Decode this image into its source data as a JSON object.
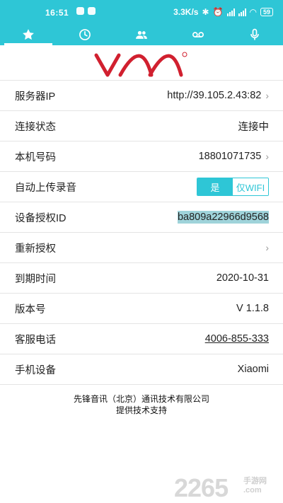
{
  "status_bar": {
    "time": "16:51",
    "network_speed": "3.3K/s",
    "battery": "59"
  },
  "tabs": [
    {
      "icon": "star-icon",
      "active": true
    },
    {
      "icon": "clock-icon",
      "active": false
    },
    {
      "icon": "contacts-icon",
      "active": false
    },
    {
      "icon": "voicemail-icon",
      "active": false
    },
    {
      "icon": "microphone-icon",
      "active": false
    }
  ],
  "logo": {
    "text": "VAA",
    "mark": "®",
    "color": "#d1202f"
  },
  "rows": [
    {
      "label": "服务器IP",
      "value": "http://39.105.2.43:82",
      "chevron": true
    },
    {
      "label": "连接状态",
      "value": "连接中"
    },
    {
      "label": "本机号码",
      "value": "18801071735",
      "chevron": true
    },
    {
      "label": "自动上传录音",
      "toggle_on": "是",
      "toggle_off": "仅WIFI"
    },
    {
      "label": "设备授权ID",
      "value": "ba809a22966d9568"
    },
    {
      "label": "重新授权",
      "chevron": true
    },
    {
      "label": "到期时间",
      "value": "2020-10-31"
    },
    {
      "label": "版本号",
      "value": "V 1.1.8"
    },
    {
      "label": "客服电话",
      "value": "4006-855-333"
    },
    {
      "label": "手机设备",
      "value": "Xiaomi"
    }
  ],
  "footer": {
    "line1": "先锋音讯（北京）通讯技术有限公司",
    "line2": "提供技术支持"
  },
  "watermark": {
    "number": "2265",
    "text": "手游网",
    "domain_mark": ".com"
  },
  "colors": {
    "accent": "#2ec6d6",
    "logo_red": "#d1202f"
  }
}
